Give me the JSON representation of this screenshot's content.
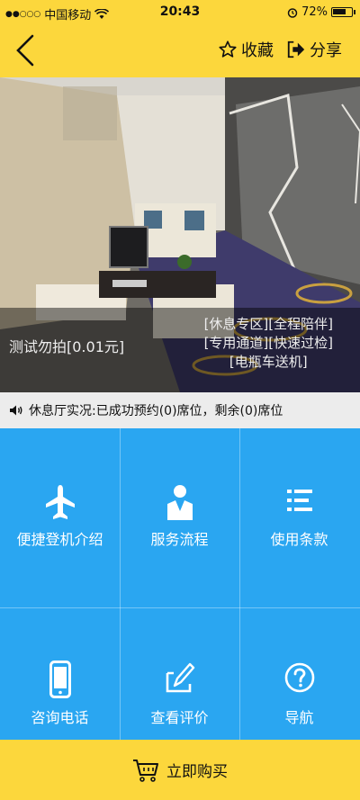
{
  "status_bar": {
    "carrier": "中国移动",
    "time": "20:43",
    "battery_text": "72%",
    "battery_level": 0.72
  },
  "nav": {
    "favorite_label": "收藏",
    "share_label": "分享"
  },
  "hero": {
    "title": "测试勿拍[0.01元]",
    "tags": [
      "[休息专区][全程陪伴]",
      "[专用通道][快速过检]",
      "[电瓶车送机]"
    ]
  },
  "notice": {
    "text": "休息厅实况:已成功预约(0)席位，剩余(0)席位"
  },
  "menu": [
    {
      "label": "便捷登机介绍",
      "icon": "airplane-icon"
    },
    {
      "label": "服务流程",
      "icon": "attendant-icon"
    },
    {
      "label": "使用条款",
      "icon": "list-icon"
    },
    {
      "label": "咨询电话",
      "icon": "phone-icon"
    },
    {
      "label": "查看评价",
      "icon": "write-review-icon"
    },
    {
      "label": "导航",
      "icon": "help-icon"
    }
  ],
  "buy": {
    "label": "立即购买",
    "icon": "cart-icon"
  },
  "colors": {
    "brand_yellow": "#fcd73c",
    "grid_blue": "#2aa6f1"
  }
}
